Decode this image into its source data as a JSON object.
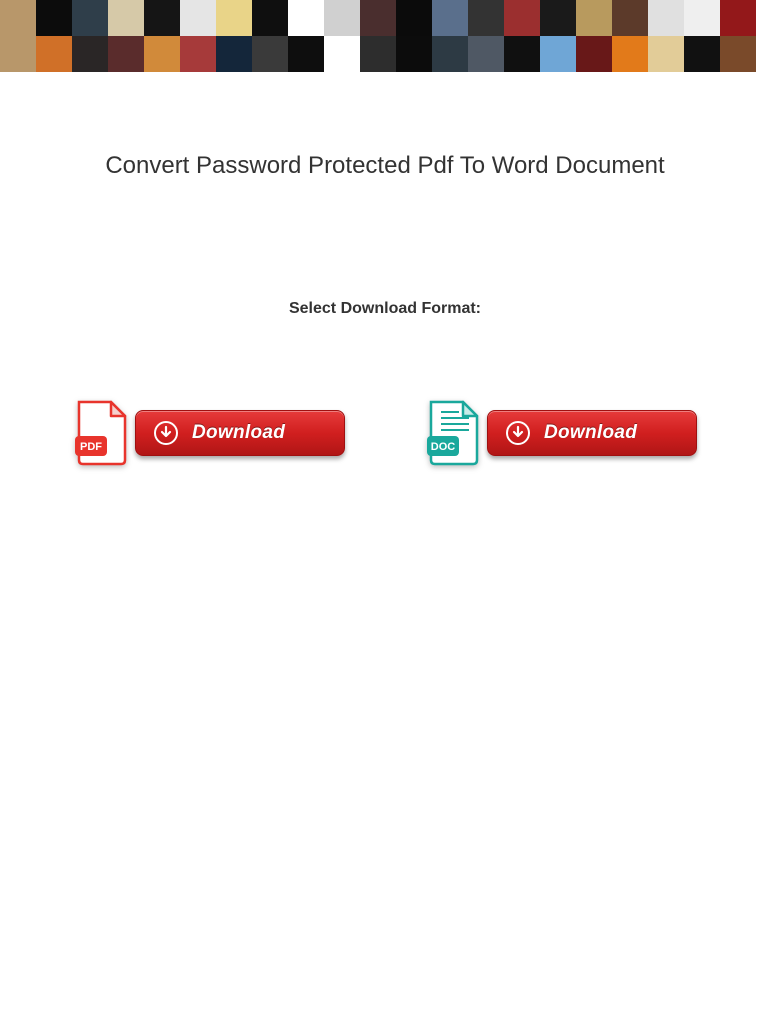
{
  "page": {
    "title": "Convert Password Protected Pdf To Word Document",
    "subtitle": "Select Download Format:"
  },
  "downloads": {
    "pdf": {
      "icon_label": "PDF",
      "button_label": "Download"
    },
    "doc": {
      "icon_label": "DOC",
      "button_label": "Download"
    }
  },
  "colors": {
    "button_red_top": "#e63b3b",
    "button_red_mid": "#d11f1f",
    "button_red_bottom": "#b01616",
    "pdf_red": "#e8342c",
    "doc_teal": "#1aa89c"
  },
  "banner_tile_colors": [
    "#b8976a",
    "#0c0c0c",
    "#2f3e4a",
    "#d6c9a8",
    "#151515",
    "#e5e5e5",
    "#e9d488",
    "#0f0f0f",
    "#ffffff",
    "#d0d0d0",
    "#4a2e2e",
    "#0b0b0b",
    "#5a6f8c",
    "#333333",
    "#9b2f2f",
    "#1a1a1a",
    "#b89a5e",
    "#5c3a2a",
    "#e0e0e0",
    "#efefef",
    "#93181a",
    "#d07028",
    "#2a2626",
    "#5a2c2c",
    "#d18a3a",
    "#a63a3a",
    "#14263a",
    "#3a3a3a",
    "#0e0e0e",
    "#ffffff",
    "#2d2d2d",
    "#0c0c0c",
    "#2d3a44",
    "#4f5864",
    "#101010",
    "#6fa6d6",
    "#681818",
    "#e27a1a",
    "#e2cc98",
    "#111111",
    "#7a4a2a",
    "#111111"
  ]
}
